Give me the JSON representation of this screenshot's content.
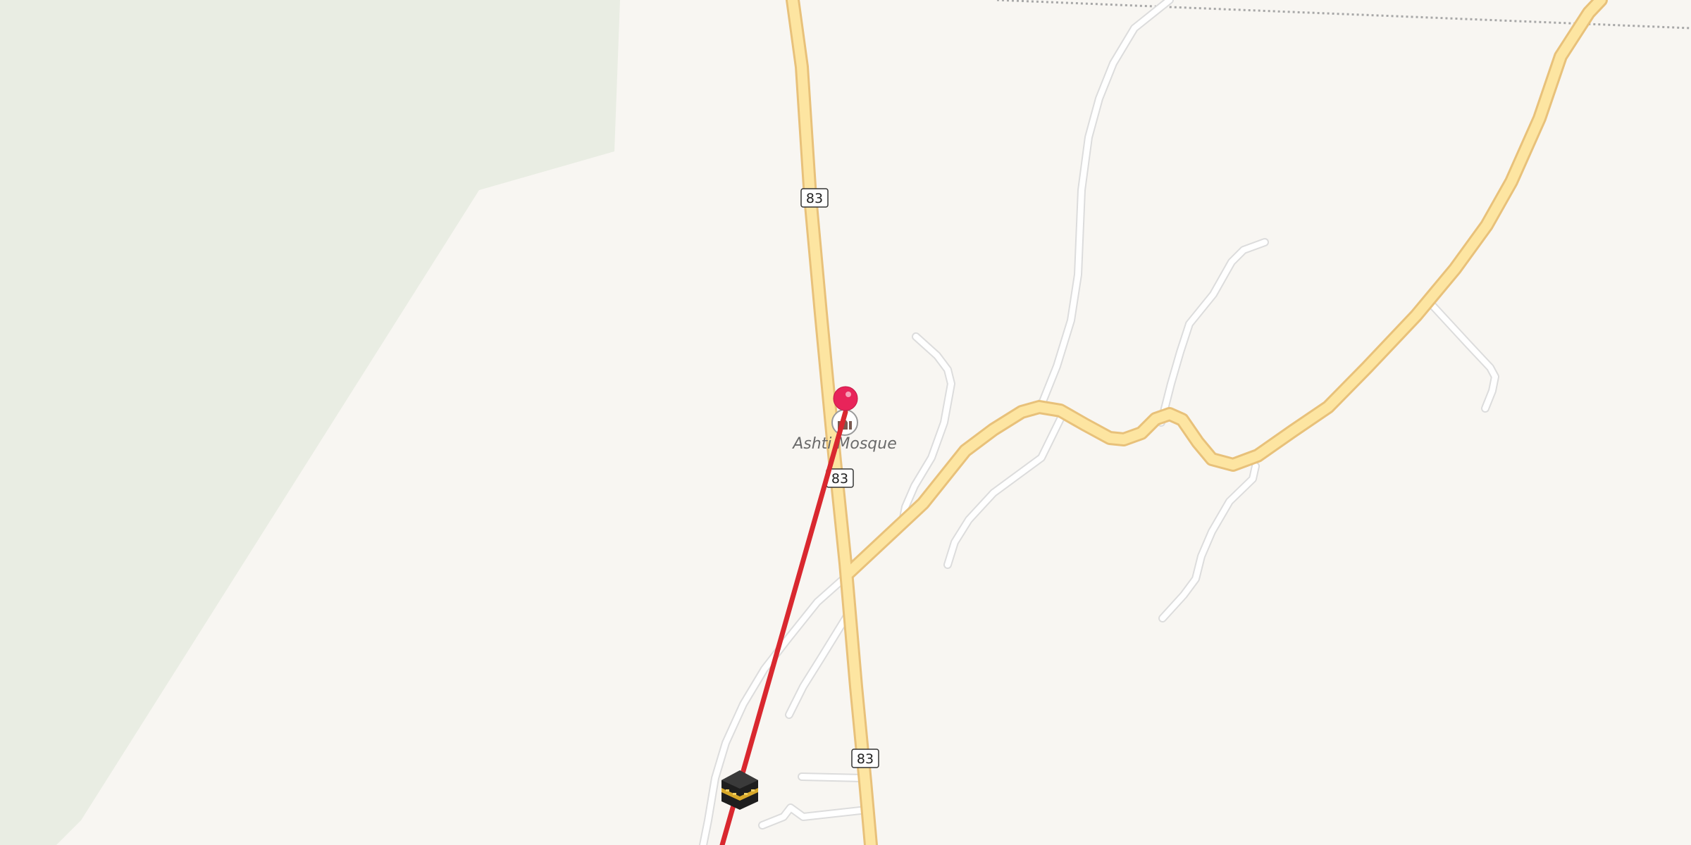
{
  "map": {
    "poi": {
      "name": "Ashti Mosque",
      "icon": "mosque-icon"
    },
    "route_shields": [
      "83",
      "83",
      "83"
    ],
    "marker": {
      "icon": "map-pin-icon",
      "color": "#e8245a"
    },
    "kaaba": {
      "icon": "kaaba-icon"
    },
    "qibla_line_color": "#d9282f",
    "colors": {
      "background": "#f8f6f2",
      "green_area": "#e9ede3",
      "primary_road_fill": "#fde5a1",
      "primary_road_casing": "#e8c17a",
      "minor_road": "#ffffff",
      "minor_road_casing": "#dcdcdc",
      "boundary": "#a8a8a8"
    }
  }
}
